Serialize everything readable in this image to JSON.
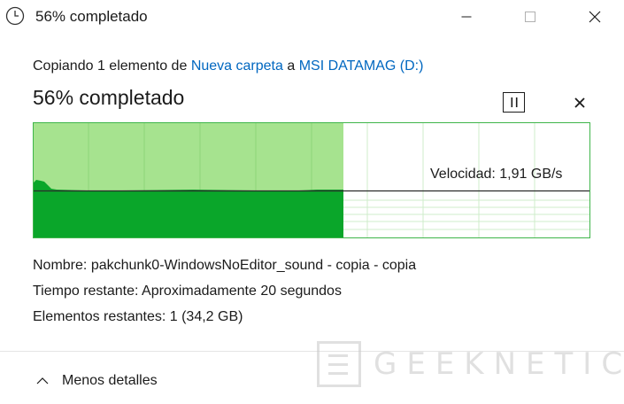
{
  "window": {
    "title": "56% completado",
    "app_icon": "clock-icon",
    "controls": {
      "minimize": "minimize-icon",
      "maximize": "maximize-icon",
      "close": "close-icon"
    }
  },
  "operation": {
    "copy_prefix": "Copiando 1 elemento de",
    "source": "Nueva carpeta",
    "connector": "a",
    "destination": "MSI DATAMAG (D:)",
    "progress_title": "56% completado",
    "progress_percent": 56,
    "pause_icon": "pause-icon",
    "cancel_icon": "close-icon"
  },
  "graph": {
    "speed_label": "Velocidad: 1,91 GB/s",
    "fill_color": "#a6e38f",
    "speed_fill_color": "#0aa62a",
    "border_color": "#3fb54a"
  },
  "details": {
    "name_label": "Nombre:",
    "name_value": "pakchunk0-WindowsNoEditor_sound - copia - copia",
    "time_label": "Tiempo restante:",
    "time_value": "Aproximadamente 20 segundos",
    "items_label": "Elementos restantes:",
    "items_value": "1 (34,2 GB)"
  },
  "footer": {
    "less_details": "Menos detalles",
    "chevron_icon": "chevron-up-icon"
  },
  "watermark": {
    "text": "GEEKNETIC"
  },
  "colors": {
    "link": "#0067c0",
    "text": "#1b1b1b"
  }
}
